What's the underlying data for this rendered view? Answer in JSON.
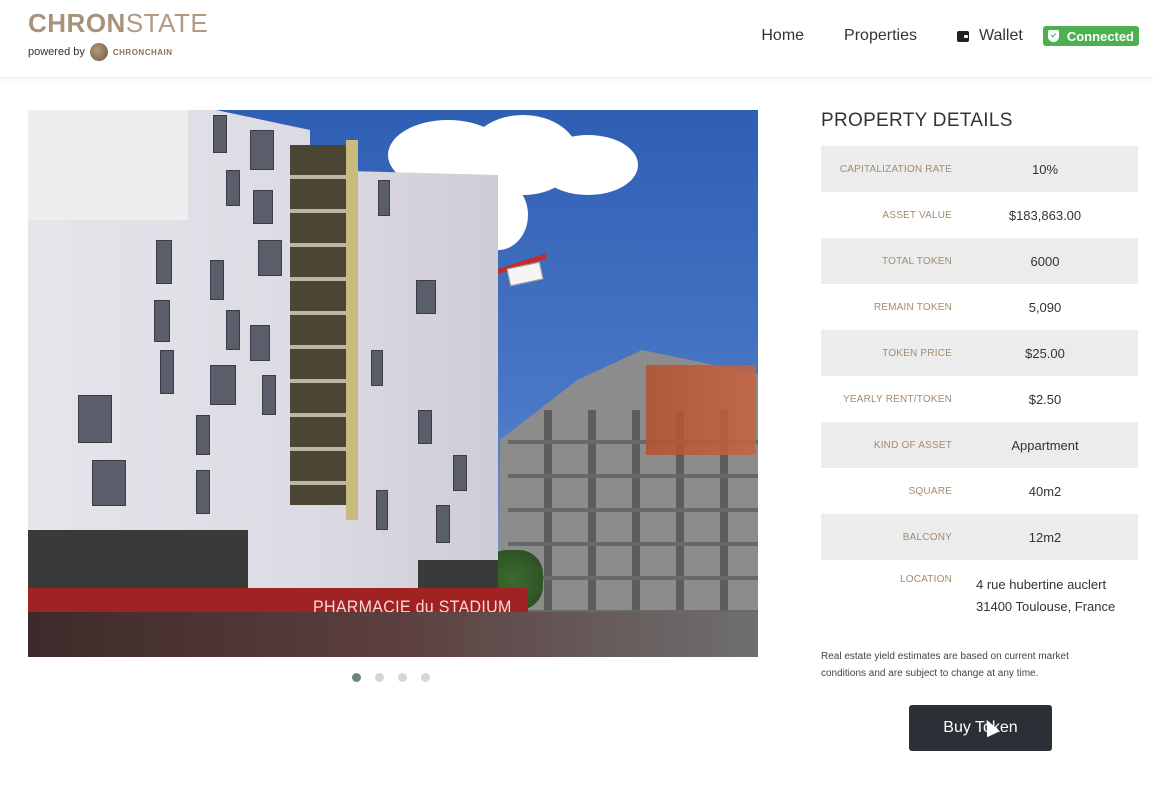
{
  "header": {
    "logo_bold": "CHRON",
    "logo_light": "STATE",
    "powered_by": "powered by",
    "chain_name": "CHRONCHAIN",
    "nav": [
      {
        "label": "Home"
      },
      {
        "label": "Properties"
      }
    ],
    "wallet_label": "Wallet",
    "status_badge": "Connected",
    "status_color": "#4caf50",
    "brand_color": "#a8927b"
  },
  "gallery": {
    "sign_text": "PHARMACIE du STADIUM",
    "slide_count": 4,
    "active_slide": 1
  },
  "details": {
    "title": "PROPERTY DETAILS",
    "rows": [
      {
        "label": "CAPITALIZATION RATE",
        "value": "10%"
      },
      {
        "label": "ASSET VALUE",
        "value": "$183,863.00"
      },
      {
        "label": "TOTAL TOKEN",
        "value": "6000"
      },
      {
        "label": "REMAIN TOKEN",
        "value": "5,090"
      },
      {
        "label": "TOKEN PRICE",
        "value": "$25.00"
      },
      {
        "label": "YEARLY RENT/TOKEN",
        "value": "$2.50"
      },
      {
        "label": "KIND OF ASSET",
        "value": "Appartment"
      },
      {
        "label": "SQUARE",
        "value": "40m2"
      },
      {
        "label": "BALCONY",
        "value": "12m2"
      }
    ],
    "location_label": "LOCATION",
    "location_line1": "4 rue hubertine auclert",
    "location_line2": "31400 Toulouse, France",
    "disclaimer_line1": "Real estate yield estimates are based on current market",
    "disclaimer_line2": "conditions and are subject to change at any time.",
    "buy_button": "Buy Token"
  }
}
